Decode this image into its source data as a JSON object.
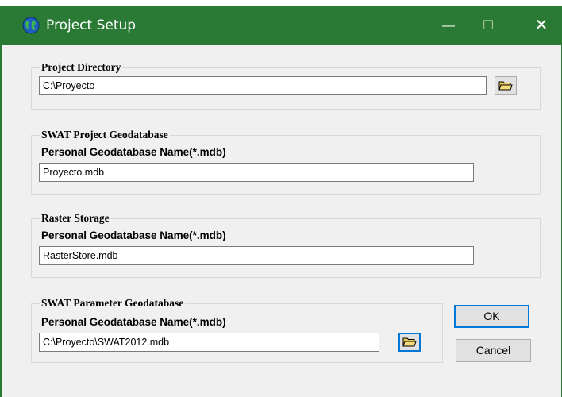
{
  "window": {
    "title": "Project Setup",
    "controls": {
      "minimize": "—",
      "maximize": "☐",
      "close": "✕"
    }
  },
  "project_directory": {
    "group_title": "Project Directory",
    "value": "C:\\Proyecto"
  },
  "swat_project_gdb": {
    "group_title": "SWAT Project Geodatabase",
    "label": "Personal Geodatabase Name(*.mdb)",
    "value": "Proyecto.mdb"
  },
  "raster_storage": {
    "group_title": "Raster Storage",
    "label": "Personal Geodatabase Name(*.mdb)",
    "value": "RasterStore.mdb"
  },
  "swat_parameter_gdb": {
    "group_title": "SWAT Parameter Geodatabase",
    "label": "Personal Geodatabase Name(*.mdb)",
    "value": "C:\\Proyecto\\SWAT2012.mdb"
  },
  "buttons": {
    "ok": "OK",
    "cancel": "Cancel"
  },
  "colors": {
    "titlebar": "#2a7a35",
    "focus": "#0078d7",
    "background": "#f0f0f0"
  }
}
